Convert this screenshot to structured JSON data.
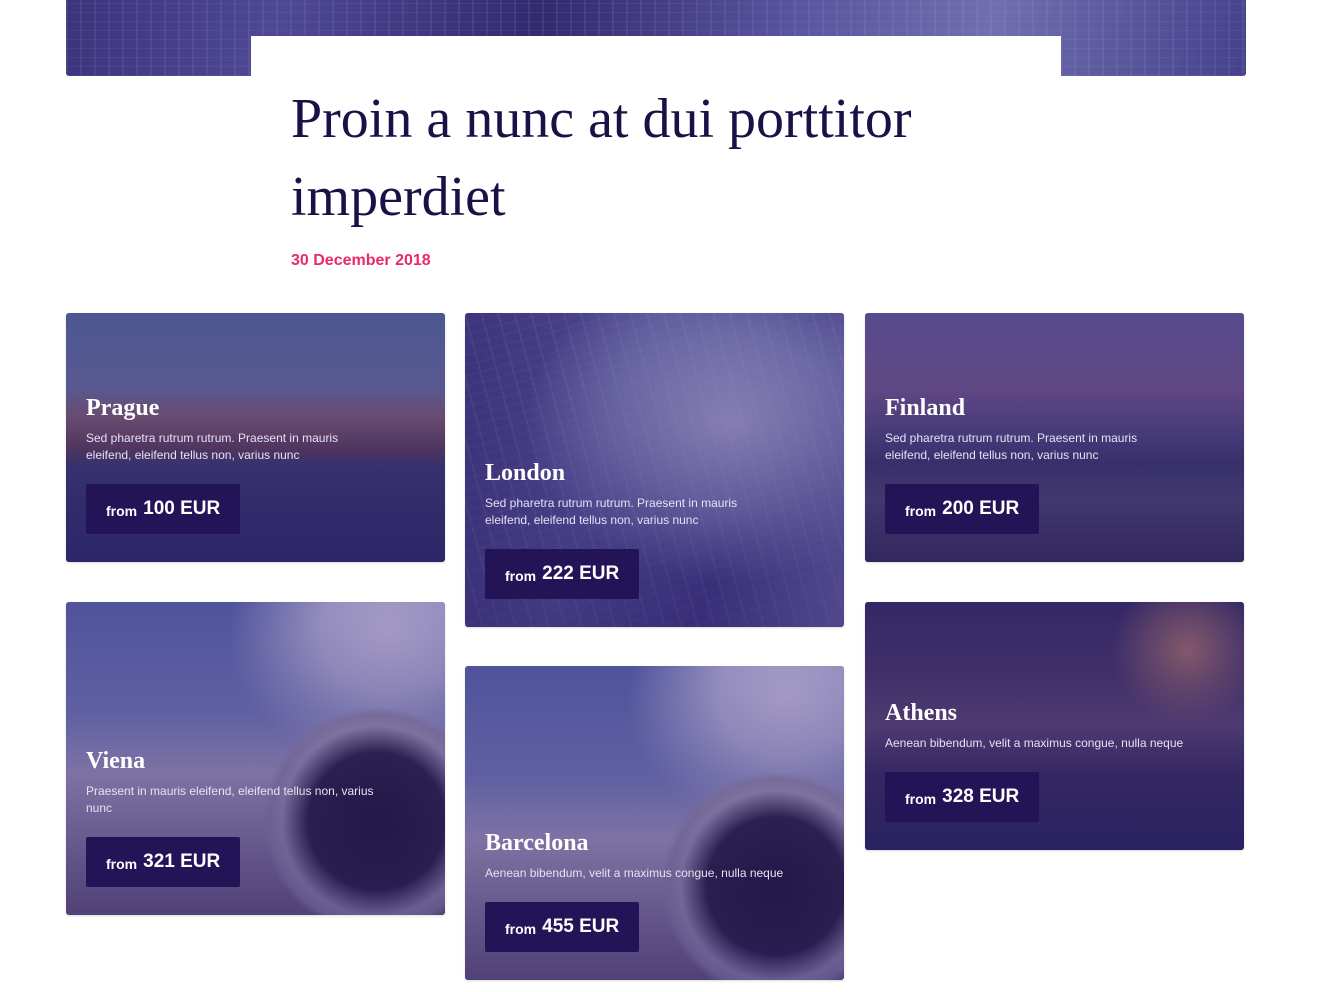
{
  "post": {
    "title": "Proin a nunc at dui porttitor imperdiet",
    "date": "30 December 2018"
  },
  "cards": [
    {
      "city": "Prague",
      "desc": "Sed pharetra rutrum rutrum. Praesent in mauris eleifend, eleifend tellus non, varius nunc",
      "from": "from",
      "price": "100 EUR"
    },
    {
      "city": "London",
      "desc": "Sed pharetra rutrum rutrum. Praesent in mauris eleifend, eleifend tellus non, varius nunc",
      "from": "from",
      "price": "222 EUR"
    },
    {
      "city": "Finland",
      "desc": "Sed pharetra rutrum rutrum. Praesent in mauris eleifend, eleifend tellus non, varius nunc",
      "from": "from",
      "price": "200 EUR"
    },
    {
      "city": "Viena",
      "desc": "Praesent in mauris eleifend, eleifend tellus non, varius nunc",
      "from": "from",
      "price": "321 EUR"
    },
    {
      "city": "Barcelona",
      "desc": "Aenean bibendum, velit a maximus congue, nulla neque",
      "from": "from",
      "price": "455 EUR"
    },
    {
      "city": "Athens",
      "desc": "Aenean bibendum, velit a maximus congue, nulla neque",
      "from": "from",
      "price": "328 EUR"
    }
  ],
  "colors": {
    "title": "#1b1147",
    "date": "#e8296d",
    "price_button": "#221457"
  }
}
